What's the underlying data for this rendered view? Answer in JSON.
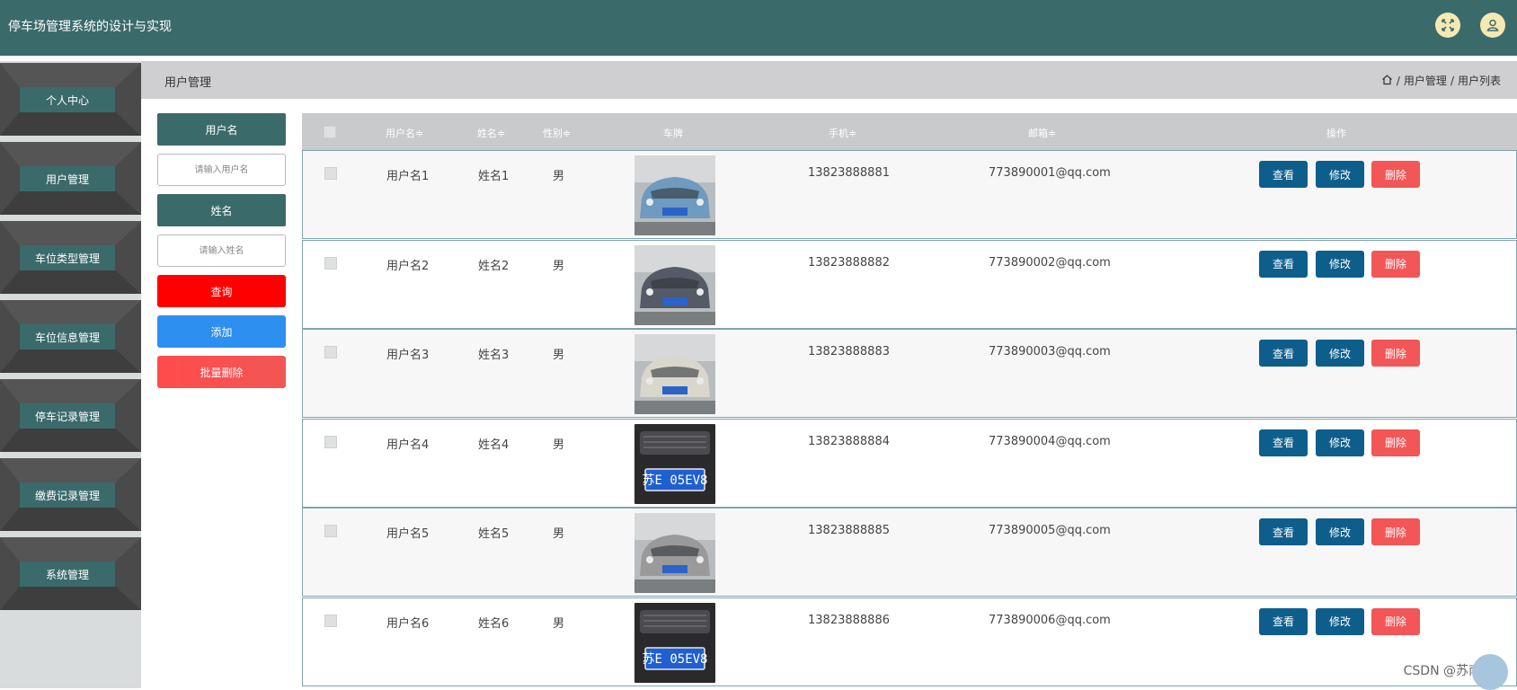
{
  "app": {
    "title": "停车场管理系统的设计与实现"
  },
  "header": {
    "icons": [
      "fullscreen-icon",
      "user-icon"
    ],
    "icon_bg": "#f5e9b3",
    "bar_color": "#3b6a6b"
  },
  "sidebar": {
    "items": [
      {
        "label": "个人中心"
      },
      {
        "label": "用户管理"
      },
      {
        "label": "车位类型管理"
      },
      {
        "label": "车位信息管理"
      },
      {
        "label": "停车记录管理"
      },
      {
        "label": "缴费记录管理"
      },
      {
        "label": "系统管理"
      }
    ]
  },
  "page": {
    "title": "用户管理",
    "breadcrumb": [
      "用户管理",
      "用户列表"
    ],
    "breadcrumb_sep": "/"
  },
  "search": {
    "username_label": "用户名",
    "username_placeholder": "请输入用户名",
    "name_label": "姓名",
    "name_placeholder": "请输入姓名",
    "query_button": "查询",
    "add_button": "添加",
    "batch_delete_button": "批量删除",
    "colors": {
      "query": "#ff0000",
      "add": "#2d8ff0",
      "batch_delete": "#ff4b4b"
    }
  },
  "table": {
    "headers": {
      "username": "用户名≑",
      "name": "姓名≑",
      "gender": "性别≑",
      "plate": "车牌",
      "phone": "手机≑",
      "email": "邮箱≑",
      "actions": "操作"
    },
    "action_labels": {
      "view": "查看",
      "edit": "修改",
      "delete": "删除"
    },
    "rows": [
      {
        "username": "用户名1",
        "name": "姓名1",
        "gender": "男",
        "phone": "13823888881",
        "email": "773890001@qq.com",
        "car_color": "#6e9bbf"
      },
      {
        "username": "用户名2",
        "name": "姓名2",
        "gender": "男",
        "phone": "13823888882",
        "email": "773890002@qq.com",
        "car_color": "#555a66"
      },
      {
        "username": "用户名3",
        "name": "姓名3",
        "gender": "男",
        "phone": "13823888883",
        "email": "773890003@qq.com",
        "car_color": "#d9d6cc"
      },
      {
        "username": "用户名4",
        "name": "姓名4",
        "gender": "男",
        "phone": "13823888884",
        "email": "773890004@qq.com",
        "car_color": "#2a2a2c",
        "plate_text": "苏E 05EV8"
      },
      {
        "username": "用户名5",
        "name": "姓名5",
        "gender": "男",
        "phone": "13823888885",
        "email": "773890005@qq.com",
        "car_color": "#9a9a9a"
      },
      {
        "username": "用户名6",
        "name": "姓名6",
        "gender": "男",
        "phone": "13823888886",
        "email": "773890006@qq.com",
        "car_color": "#2a2a2c",
        "plate_text": "苏E 05EV8"
      }
    ]
  },
  "watermark": "CSDN @苏南学弟"
}
